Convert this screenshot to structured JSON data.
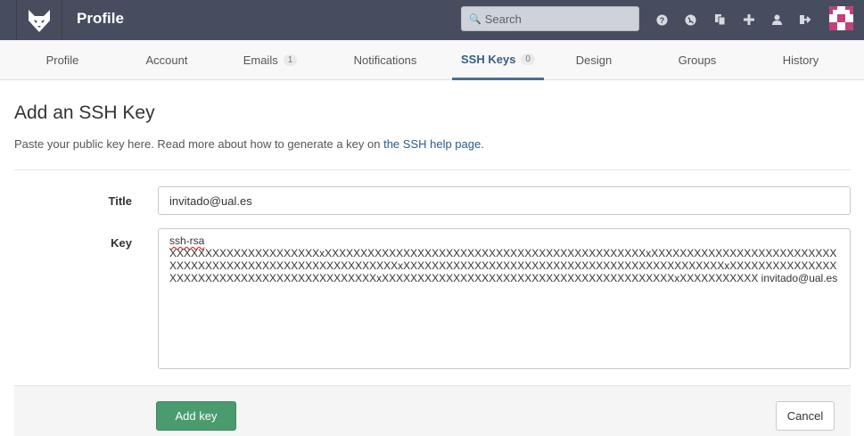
{
  "header": {
    "title": "Profile",
    "search_placeholder": "Search",
    "icons": [
      "help-icon",
      "globe-icon",
      "copy-icon",
      "plus-icon",
      "user-icon",
      "sign-out-icon"
    ]
  },
  "nav": {
    "tabs": [
      {
        "label": "Profile",
        "badge": null,
        "active": false
      },
      {
        "label": "Account",
        "badge": null,
        "active": false
      },
      {
        "label": "Emails",
        "badge": "1",
        "active": false
      },
      {
        "label": "Notifications",
        "badge": null,
        "active": false
      },
      {
        "label": "SSH Keys",
        "badge": "0",
        "active": true
      },
      {
        "label": "Design",
        "badge": null,
        "active": false
      },
      {
        "label": "Groups",
        "badge": null,
        "active": false
      },
      {
        "label": "History",
        "badge": null,
        "active": false
      }
    ]
  },
  "main": {
    "title": "Add an SSH Key",
    "intro_text": "Paste your public key here. Read more about how to generate a key on ",
    "intro_link": "the SSH help page",
    "intro_end": "."
  },
  "form": {
    "title_label": "Title",
    "title_value": "invitado@ual.es",
    "key_label": "Key",
    "key_line1": "ssh-rsa",
    "key_body": "XXXXXXXXXXXXXXXXXXXXXxXXXXXXXXXXXXXXXXXXXXXXXXXXXXXXXXXXXXXXXXXXXXXxXXXXXXXXXXXXXXXXXXXXXXXXXXXXXXXXXXXXXXXXXXXXXXXXXXXXXXXXXXxXXXXXXXXXXXXXXXXXXXXXXXXXXXXXXXXXXXXXXXXXXXXXxXXXXXXXXXXXXXXXXXXXXXXXXXXXXXXXXXXXXXXXXXXXXxXXXXXXXXXXXXXXXXXXXXXXXXXXXXXXXXXXXXXXXXXxXXXXXXXXXXX invitado@ual.es"
  },
  "footer": {
    "add_label": "Add key",
    "cancel_label": "Cancel"
  },
  "colors": {
    "header_bg": "#474d5e",
    "active_tab": "#4b6c96",
    "link": "#2b5a8c",
    "primary_button": "#4a9b6e"
  }
}
